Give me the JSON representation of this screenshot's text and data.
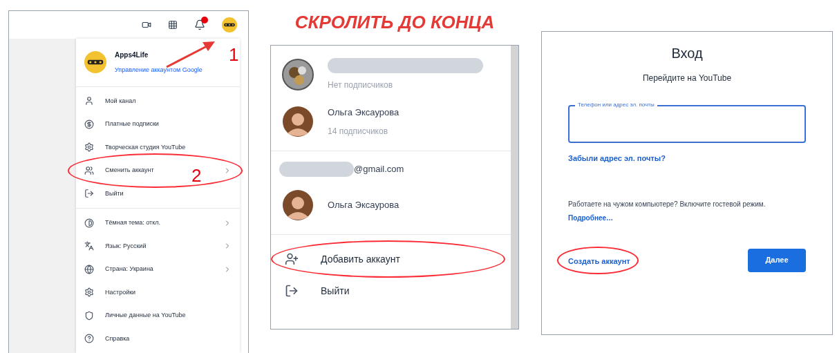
{
  "annotation_title": "СКРОЛИТЬ ДО КОНЦА",
  "youtube_menu": {
    "account_name": "Apps4Life",
    "manage_link": "Управление аккаунтом Google",
    "step_labels": [
      "1",
      "2"
    ],
    "groups": [
      [
        {
          "label": "Мой канал",
          "has_submenu": false,
          "circled": false
        },
        {
          "label": "Платные подписки",
          "has_submenu": false,
          "circled": false
        },
        {
          "label": "Творческая студия YouTube",
          "has_submenu": false,
          "circled": false
        },
        {
          "label": "Сменить аккаунт",
          "has_submenu": true,
          "circled": true
        },
        {
          "label": "Выйти",
          "has_submenu": false,
          "circled": false
        }
      ],
      [
        {
          "label": "Тёмная тема: откл.",
          "has_submenu": true,
          "circled": false
        },
        {
          "label": "Язык: Русский",
          "has_submenu": true,
          "circled": false
        },
        {
          "label": "Страна: Украина",
          "has_submenu": true,
          "circled": false
        },
        {
          "label": "Настройки",
          "has_submenu": false,
          "circled": false
        },
        {
          "label": "Личные данные на YouTube",
          "has_submenu": false,
          "circled": false
        },
        {
          "label": "Справка",
          "has_submenu": false,
          "circled": false
        }
      ]
    ]
  },
  "account_switcher": {
    "sections": [
      {
        "accounts": [
          {
            "name_hidden": true,
            "subtitle": "Нет подписчиков"
          },
          {
            "name": "Ольга Эксаурова",
            "name_hidden": false,
            "subtitle": "14 подписчиков"
          }
        ]
      },
      {
        "email_suffix": "@gmail.com",
        "accounts": [
          {
            "name": "Ольга Эксаурова",
            "name_hidden": false
          }
        ]
      }
    ],
    "actions": [
      {
        "label": "Добавить аккаунт",
        "circled": true
      },
      {
        "label": "Выйти",
        "circled": false
      }
    ]
  },
  "sign_in": {
    "title": "Вход",
    "subtitle": "Перейдите на YouTube",
    "field_label": "Телефон или адрес эл. почты",
    "forgot_link": "Забыли адрес эл. почты?",
    "guest_note": "Работаете на чужом компьютере? Включите гостевой режим.",
    "guest_link": "Подробнее…",
    "create_link": "Создать аккаунт",
    "create_circled": true,
    "next_button": "Далее"
  }
}
